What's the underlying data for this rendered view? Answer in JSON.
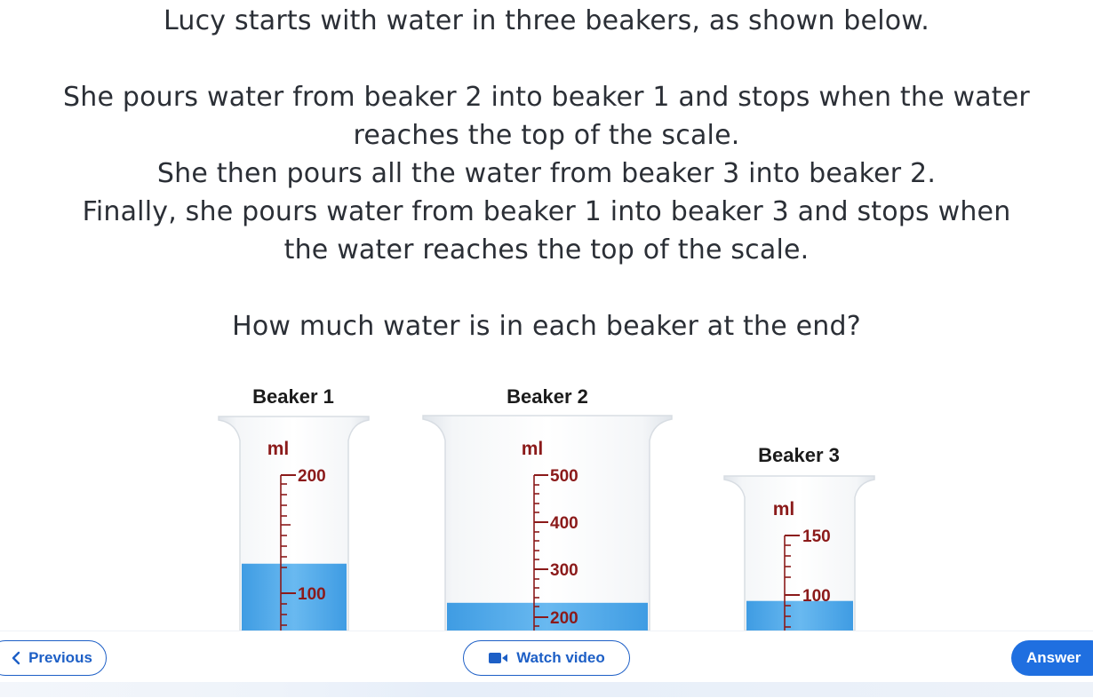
{
  "question": {
    "line1": "Lucy starts with water in three beakers, as shown below.",
    "line2": "She pours water from beaker 2 into beaker 1 and stops when the water",
    "line3": "reaches the top of the scale.",
    "line4": "She then pours all the water from beaker 3 into beaker 2.",
    "line5": "Finally, she pours water from beaker 1 into beaker 3 and stops when",
    "line6": "the water reaches the top of the scale.",
    "ask": "How much water is in each beaker at the end?"
  },
  "beakers": [
    {
      "label": "Beaker 1",
      "unit": "ml",
      "scale_top": "200",
      "scale_mid": "100",
      "water_ml": 125
    },
    {
      "label": "Beaker 2",
      "unit": "ml",
      "scale_top": "500",
      "scale_2": "400",
      "scale_3": "300",
      "scale_4": "200",
      "water_ml": 230
    },
    {
      "label": "Beaker 3",
      "unit": "ml",
      "scale_top": "150",
      "scale_mid": "100",
      "water_ml": 95
    }
  ],
  "colors": {
    "water": "#4da6e8",
    "scale": "#8b1a1a",
    "glass": "#eef1f4",
    "accent": "#1d5fc6"
  },
  "footer": {
    "previous_label": "Previous",
    "video_label": "Watch video",
    "answer_label": "Answer",
    "previous_icon": "chevron-left-icon",
    "video_icon": "video-camera-icon"
  }
}
